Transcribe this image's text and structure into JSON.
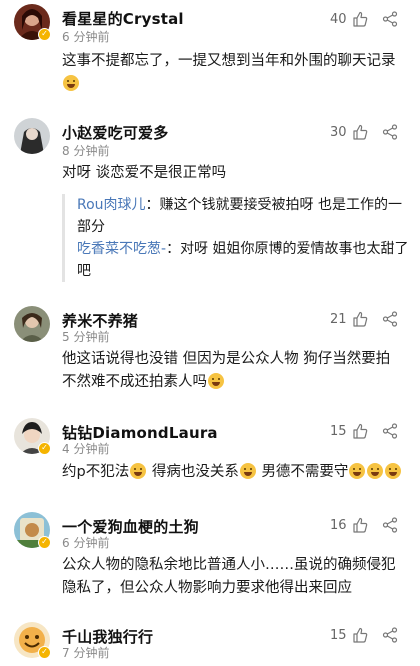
{
  "comments": [
    {
      "user": "看星星的Crystal",
      "time": "6 分钟前",
      "likes": "40",
      "text_lines": [
        "这事不提都忘了，一提又想到当年和外围的聊天记录"
      ],
      "has_emoji_line": true
    },
    {
      "user": "小赵爱吃可爱多",
      "time": "8 分钟前",
      "likes": "30",
      "text_lines": [
        "对呀 谈恋爱不是很正常吗"
      ],
      "replies": [
        {
          "name": "Rou肉球儿",
          "sep": "：",
          "line1": "赚这个钱就要接受被拍呀 也是工作的一",
          "line2": "部分"
        },
        {
          "name": "吃香菜不吃葱-",
          "sep": "：",
          "line1": "对呀 姐姐你原博的爱情故事也太甜了",
          "line2": "吧"
        }
      ]
    },
    {
      "user": "养米不养猪",
      "time": "5 分钟前",
      "likes": "21",
      "text_lines": [
        "他这话说得也没错 但因为是公众人物 狗仔当然要拍",
        "不然难不成还拍素人吗"
      ]
    },
    {
      "user": "钻钻DiamondLaura",
      "time": "4 分钟前",
      "likes": "15",
      "text_parts": [
        "约p不犯法",
        "得病也没关系",
        "男德不需要守"
      ]
    },
    {
      "user": "一个爱狗血梗的土狗",
      "time": "6 分钟前",
      "likes": "16",
      "text_lines": [
        "公众人物的隐私余地比普通人小……虽说的确频侵犯",
        "隐私了，但公众人物影响力要求他得出来回应"
      ]
    },
    {
      "user": "千山我独行行",
      "time": "7 分钟前",
      "likes": "15"
    }
  ],
  "icons": {
    "like": "thumbs-up-icon",
    "share": "share-icon",
    "badge": "verified-badge-icon"
  },
  "colors": {
    "reply_name": "#4a78b8",
    "badge": "#f5b400",
    "meta": "#8a8a8a"
  }
}
